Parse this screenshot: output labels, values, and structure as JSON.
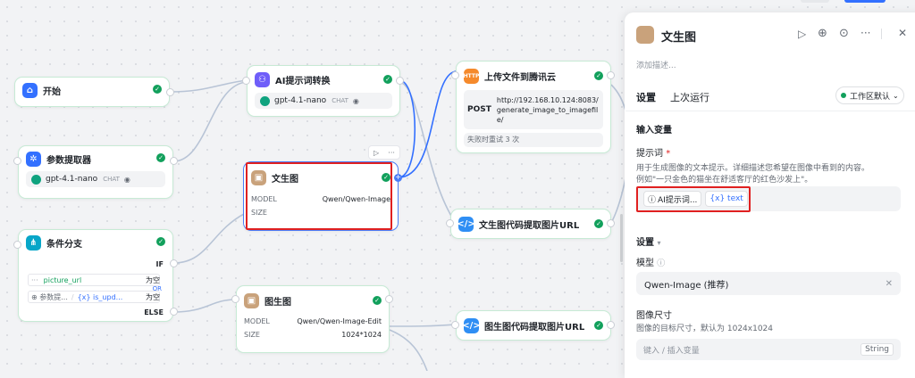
{
  "canvas": {
    "start": {
      "title": "开始"
    },
    "param": {
      "title": "参数提取器",
      "model": "gpt-4.1-nano",
      "model_tag": "CHAT"
    },
    "cond": {
      "title": "条件分支",
      "if_label": "IF",
      "else_label": "ELSE",
      "or_label": "OR",
      "rows": [
        {
          "dots": "···",
          "var": "picture_url",
          "op": "为空"
        },
        {
          "dots": "⊕ 参数提...",
          "sep": "/",
          "var": "{x} is_upd...",
          "op": "为空"
        }
      ]
    },
    "ai": {
      "title": "AI提示词转换",
      "model": "gpt-4.1-nano",
      "model_tag": "CHAT"
    },
    "wst": {
      "title": "文生图",
      "rows": [
        {
          "k": "MODEL",
          "v": "Qwen/Qwen-Image"
        },
        {
          "k": "SIZE",
          "v": ""
        }
      ]
    },
    "tst": {
      "title": "图生图",
      "rows": [
        {
          "k": "MODEL",
          "v": "Qwen/Qwen-Image-Edit"
        },
        {
          "k": "SIZE",
          "v": "1024*1024"
        }
      ]
    },
    "upload": {
      "title": "上传文件到腾讯云",
      "method": "POST",
      "url": "http://192.168.10.124:8083/generate_image_to_imagefile/",
      "retry": "失败时重试 3 次"
    },
    "code1": {
      "title": "文生图代码提取图片URL"
    },
    "code2": {
      "title": "图生图代码提取图片URL"
    }
  },
  "panel": {
    "title": "文生图",
    "desc_placeholder": "添加描述...",
    "tabs": [
      "设置",
      "上次运行"
    ],
    "env": "工作区默认",
    "input_section": "输入变量",
    "prompt_label": "提示词",
    "required_mark": "*",
    "prompt_desc_1": "用于生成图像的文本提示。详细描述您希望在图像中看到的内容。",
    "prompt_desc_2": "例如\"一只金色的猫坐在舒适客厅的红色沙发上\"。",
    "prompt_var1": "AI提示词...",
    "prompt_var2": "{x} text",
    "settings_section": "设置",
    "model_label": "模型",
    "model_value": "Qwen-Image (推荐)",
    "size_label": "图像尺寸",
    "size_desc": "图像的目标尺寸，默认为 1024x1024",
    "size_placeholder": "键入 / 插入变量",
    "size_type": "String"
  },
  "colors": {
    "accent": "#4a7cf7",
    "success": "#12a05c",
    "highlight": "#e02020",
    "node_border": "#c7ead5"
  }
}
